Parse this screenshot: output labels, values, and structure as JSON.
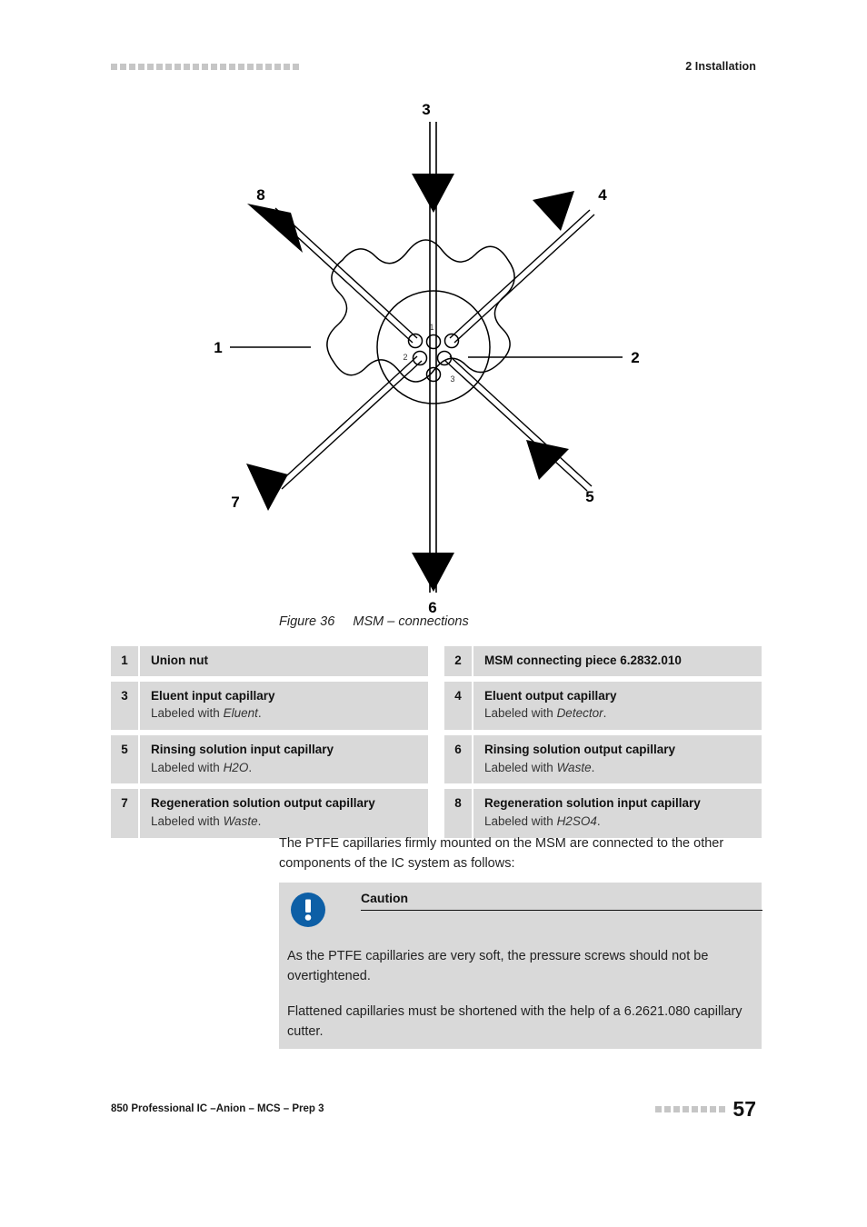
{
  "header": {
    "chapter": "2 Installation",
    "marker_count": 21,
    "marker_color": "#c6c6c6"
  },
  "figure": {
    "caption_number": "Figure 36",
    "caption_text": "MSM – connections",
    "caption_full": "Figure 36     MSM – connections",
    "callouts": [
      {
        "id": "3",
        "label": "3",
        "direction": "top",
        "flow": "in"
      },
      {
        "id": "4",
        "label": "4",
        "direction": "top-right",
        "flow": "out"
      },
      {
        "id": "5",
        "label": "5",
        "direction": "bottom-right",
        "flow": "in"
      },
      {
        "id": "6",
        "label": "6",
        "direction": "bottom",
        "flow": "out"
      },
      {
        "id": "7",
        "label": "7",
        "direction": "bottom-left",
        "flow": "out"
      },
      {
        "id": "8",
        "label": "8",
        "direction": "top-left",
        "flow": "out"
      },
      {
        "id": "1",
        "label": "1",
        "direction": "left",
        "flow": "leader"
      },
      {
        "id": "2",
        "label": "2",
        "direction": "right",
        "flow": "leader"
      }
    ],
    "port_labels": [
      "1",
      "2",
      "3"
    ]
  },
  "legend": {
    "items": [
      {
        "num": "1",
        "title": "Union nut",
        "sub_prefix": "",
        "sub_italic": "",
        "sub_suffix": ""
      },
      {
        "num": "2",
        "title": "MSM connecting piece 6.2832.010",
        "sub_prefix": "",
        "sub_italic": "",
        "sub_suffix": ""
      },
      {
        "num": "3",
        "title": "Eluent input capillary",
        "sub_prefix": "Labeled with ",
        "sub_italic": "Eluent",
        "sub_suffix": "."
      },
      {
        "num": "4",
        "title": "Eluent output capillary",
        "sub_prefix": "Labeled with ",
        "sub_italic": "Detector",
        "sub_suffix": "."
      },
      {
        "num": "5",
        "title": "Rinsing solution input capillary",
        "sub_prefix": "Labeled with ",
        "sub_italic": "H2O",
        "sub_suffix": "."
      },
      {
        "num": "6",
        "title": "Rinsing solution output capillary",
        "sub_prefix": "Labeled with ",
        "sub_italic": "Waste",
        "sub_suffix": "."
      },
      {
        "num": "7",
        "title": "Regeneration solution output capillary",
        "sub_prefix": "Labeled with ",
        "sub_italic": "Waste",
        "sub_suffix": "."
      },
      {
        "num": "8",
        "title": "Regeneration solution input capillary",
        "sub_prefix": "Labeled with ",
        "sub_italic": "H2SO4",
        "sub_suffix": "."
      }
    ],
    "row_background": "#d9d9d9"
  },
  "body": {
    "paragraph": "The PTFE capillaries firmly mounted on the MSM are connected to the other components of the IC system as follows:"
  },
  "caution": {
    "title": "Caution",
    "icon_color": "#0d5fa6",
    "background": "#d9d9d9",
    "paragraphs": [
      "As the PTFE capillaries are very soft, the pressure screws should not be overtightened.",
      "Flattened capillaries must be shortened with the help of a 6.2621.080 capillary cutter."
    ]
  },
  "footer": {
    "document_title": "850 Professional IC –Anion – MCS – Prep 3",
    "page_number": "57",
    "marker_count": 8,
    "marker_color": "#c6c6c6"
  }
}
